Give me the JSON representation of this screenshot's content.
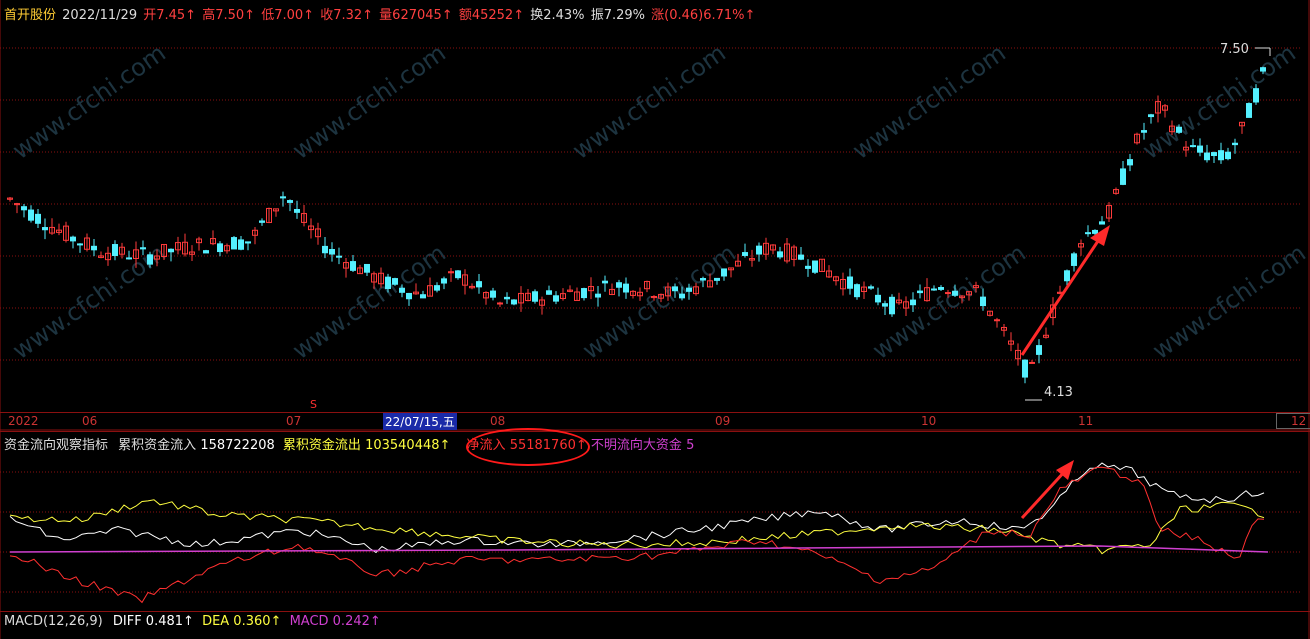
{
  "header": {
    "stock_name": "首开股份",
    "date": "2022/11/29",
    "open": "开7.45↑",
    "high": "高7.50↑",
    "low": "低7.00↑",
    "close": "收7.32↑",
    "volume": "量627045↑",
    "amount": "额45252↑",
    "turnover": "换2.43%",
    "amplitude": "振7.29%",
    "change": "涨(0.46)6.71%↑"
  },
  "price_labels": {
    "high": "7.50",
    "low": "4.13"
  },
  "x_axis": {
    "labels": [
      "2022",
      "06",
      "07",
      "08",
      "09",
      "10",
      "11",
      "12"
    ],
    "cursor_label": "22/07/15,五",
    "s_marker": "S"
  },
  "indicator": {
    "name": "资金流向观察指标",
    "inflow_label": "累积资金流入",
    "inflow_value": "158722208",
    "outflow_label": "累积资金流出",
    "outflow_value": "103540448↑",
    "net_label": "净流入",
    "net_value": "55181760↑",
    "unknown_label": "不明流向大资金",
    "unknown_value": "5"
  },
  "macd": {
    "name": "MACD(12,26,9)",
    "diff": "DIFF 0.481↑",
    "dea": "DEA 0.360↑",
    "macd": "MACD 0.242↑"
  },
  "watermark": "www.cfchi.com",
  "colors": {
    "up": "#ff3b3b",
    "down": "#54f0ff",
    "grid": "#8a1010",
    "accent": "#ff3030"
  },
  "chart_data": {
    "type": "candlestick",
    "title": "首开股份",
    "ylim": [
      4.0,
      7.6
    ],
    "series": [
      {
        "name": "净流入",
        "color": "#ff3030"
      },
      {
        "name": "累积资金流出",
        "color": "#ffff40"
      },
      {
        "name": "累积资金流入",
        "color": "#ffffff"
      },
      {
        "name": "不明流向大资金",
        "color": "#d040d0"
      }
    ]
  }
}
